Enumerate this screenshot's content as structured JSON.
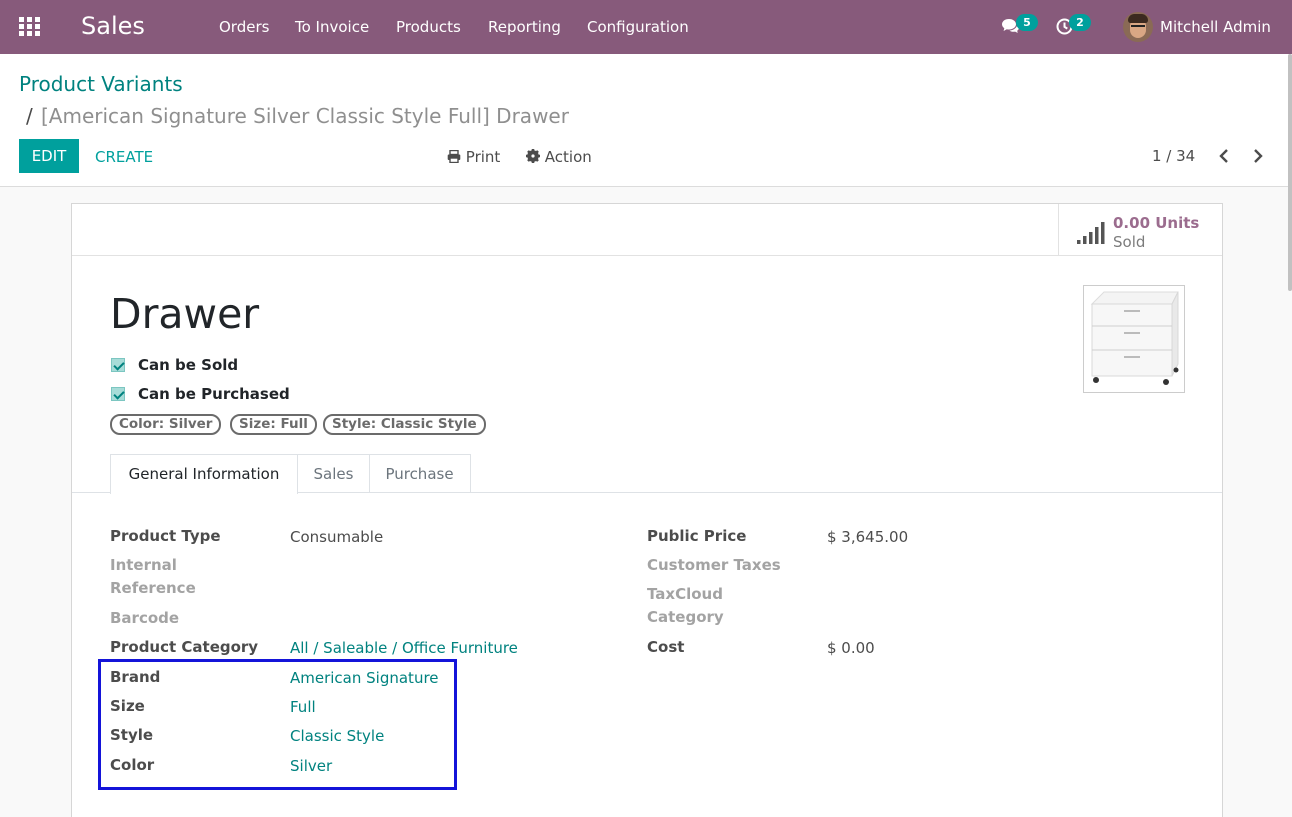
{
  "navbar": {
    "app_name": "Sales",
    "menu": [
      "Orders",
      "To Invoice",
      "Products",
      "Reporting",
      "Configuration"
    ],
    "messages_count": "5",
    "activities_count": "2",
    "user_name": "Mitchell Admin",
    "color": "#875a7b"
  },
  "breadcrumb": {
    "parent": "Product Variants",
    "separator": "/",
    "current": "[American Signature Silver Classic Style Full] Drawer"
  },
  "toolbar": {
    "edit_label": "EDIT",
    "create_label": "CREATE",
    "print_label": "Print",
    "action_label": "Action"
  },
  "pager": {
    "value": "1 / 34"
  },
  "stat_button": {
    "value": "0.00 Units",
    "label": "Sold"
  },
  "product": {
    "name": "Drawer",
    "can_be_sold_label": "Can be Sold",
    "can_be_purchased_label": "Can be Purchased",
    "can_be_sold": true,
    "can_be_purchased": true,
    "tags": [
      "Color: Silver",
      "Size: Full",
      "Style: Classic Style"
    ]
  },
  "tabs": [
    "General Information",
    "Sales",
    "Purchase"
  ],
  "fields_left": {
    "product_type": {
      "label": "Product Type",
      "value": "Consumable"
    },
    "internal_reference": {
      "label_line1": "Internal",
      "label_line2": "Reference",
      "value": ""
    },
    "barcode": {
      "label": "Barcode",
      "value": ""
    },
    "product_category": {
      "label": "Product Category",
      "value": "All / Saleable / Office Furniture"
    },
    "brand": {
      "label": "Brand",
      "value": "American Signature"
    },
    "size": {
      "label": "Size",
      "value": "Full"
    },
    "style": {
      "label": "Style",
      "value": "Classic Style"
    },
    "color": {
      "label": "Color",
      "value": "Silver"
    }
  },
  "fields_right": {
    "public_price": {
      "label": "Public Price",
      "value": "$ 3,645.00"
    },
    "customer_taxes": {
      "label": "Customer Taxes",
      "value": ""
    },
    "taxcloud_category": {
      "label_line1": "TaxCloud",
      "label_line2": "Category",
      "value": ""
    },
    "cost": {
      "label": "Cost",
      "value": "$ 0.00"
    }
  },
  "colors": {
    "accent": "#00a09d",
    "link": "#00827f",
    "highlight_box": "#1414d9"
  }
}
